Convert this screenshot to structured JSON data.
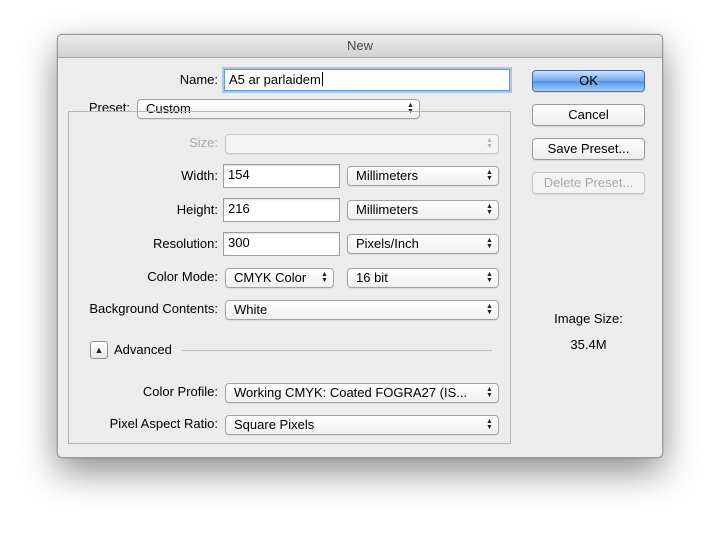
{
  "window": {
    "title": "New"
  },
  "name": {
    "label": "Name:",
    "value": "A5 ar parlaidem"
  },
  "preset": {
    "label": "Preset:",
    "value": "Custom"
  },
  "size": {
    "label": "Size:",
    "value": ""
  },
  "width": {
    "label": "Width:",
    "value": "154",
    "unit": "Millimeters"
  },
  "height": {
    "label": "Height:",
    "value": "216",
    "unit": "Millimeters"
  },
  "resolution": {
    "label": "Resolution:",
    "value": "300",
    "unit": "Pixels/Inch"
  },
  "color_mode": {
    "label": "Color Mode:",
    "mode": "CMYK Color",
    "depth": "16 bit"
  },
  "background_contents": {
    "label": "Background Contents:",
    "value": "White"
  },
  "advanced": {
    "label": "Advanced",
    "expanded": true
  },
  "color_profile": {
    "label": "Color Profile:",
    "value": "Working CMYK:  Coated FOGRA27 (IS..."
  },
  "pixel_aspect_ratio": {
    "label": "Pixel Aspect Ratio:",
    "value": "Square Pixels"
  },
  "buttons": {
    "ok": "OK",
    "cancel": "Cancel",
    "save_preset": "Save Preset...",
    "delete_preset": "Delete Preset..."
  },
  "image_size": {
    "label": "Image Size:",
    "value": "35.4M"
  },
  "icons": {
    "popup_arrows": "updown-arrows-icon",
    "disclosure": "triangle-up-icon"
  },
  "colors": {
    "default_button": "#4c94ea",
    "focus_ring": "#a9c7ee",
    "window_bg": "#ececec"
  }
}
